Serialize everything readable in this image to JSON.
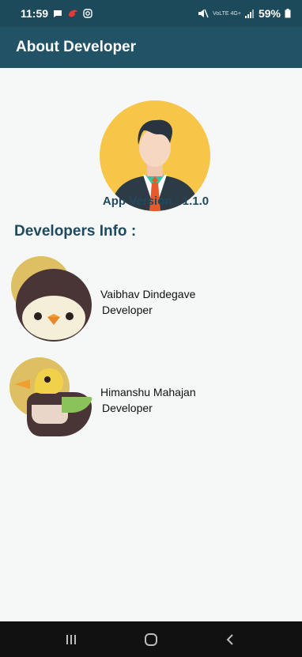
{
  "status_bar": {
    "time": "11:59",
    "network_label": "VoLTE 4G+",
    "battery_percent": "59%",
    "icons": [
      "chat-icon",
      "app-notification-icon",
      "instagram-icon",
      "mute-icon",
      "signal-icon",
      "battery-icon"
    ]
  },
  "app_bar": {
    "title": "About Developer"
  },
  "main": {
    "version_text": "App Version : 1.1.0",
    "section_title": "Developers Info :",
    "developers": [
      {
        "name": "Vaibhav Dindegave",
        "role": "Developer",
        "avatar": "penguin-icon"
      },
      {
        "name": "Himanshu Mahajan",
        "role": "Developer",
        "avatar": "duck-icon"
      }
    ]
  },
  "nav_bar": {
    "buttons": [
      "recent-apps-icon",
      "home-icon",
      "back-icon"
    ]
  },
  "colors": {
    "app_bar": "#215266",
    "status_bar": "#1c4a5a",
    "accent_text": "#1f4a5e",
    "avatar_bg": "#f7c648",
    "nav_bar": "#111111"
  }
}
